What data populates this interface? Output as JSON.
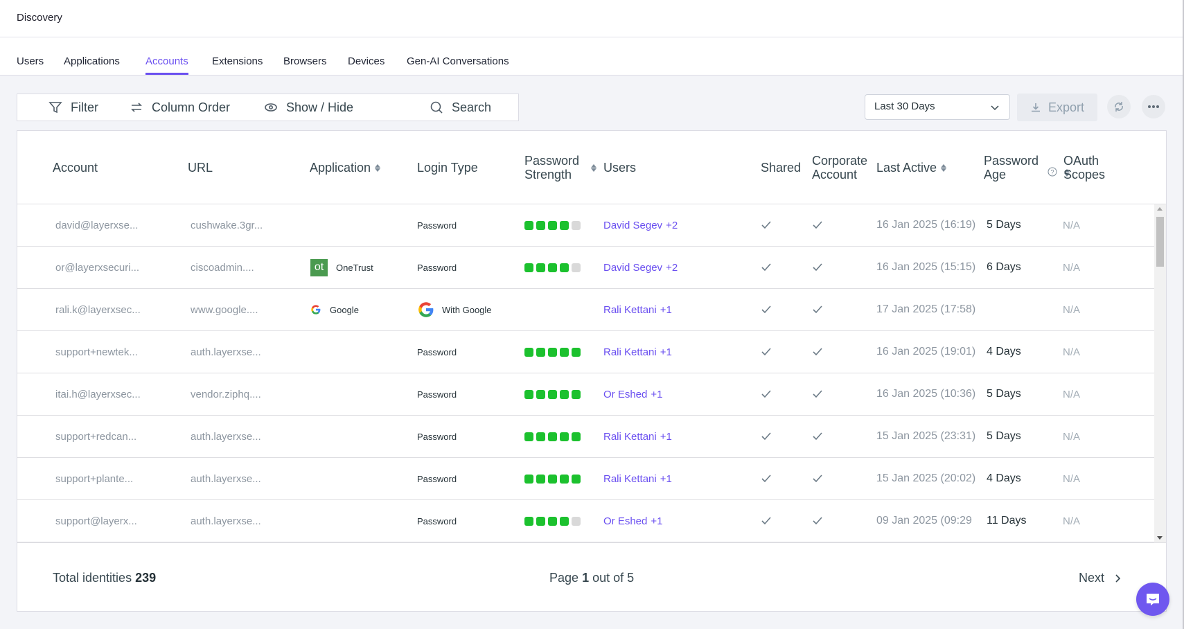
{
  "header": {
    "title": "Discovery"
  },
  "tabs": [
    {
      "label": "Users",
      "active": false
    },
    {
      "label": "Applications",
      "active": false
    },
    {
      "label": "Accounts",
      "active": true
    },
    {
      "label": "Extensions",
      "active": false
    },
    {
      "label": "Browsers",
      "active": false
    },
    {
      "label": "Devices",
      "active": false
    },
    {
      "label": "Gen-AI Conversations",
      "active": false
    }
  ],
  "toolbar": {
    "filter_label": "Filter",
    "column_order_label": "Column Order",
    "show_hide_label": "Show / Hide",
    "search_label": "Search",
    "date_range": "Last 30 Days",
    "export_label": "Export"
  },
  "colors": {
    "accent": "#6a4ff0",
    "strength_on": "#1cc12e",
    "strength_off": "#d9d9d9",
    "onetrust": "#4a9a4f"
  },
  "table": {
    "columns": [
      {
        "label": "Account",
        "sortable": false
      },
      {
        "label": "URL",
        "sortable": false
      },
      {
        "label": "Application",
        "sortable": true
      },
      {
        "label": "Login Type",
        "sortable": false
      },
      {
        "label": "Password Strength",
        "sortable": true
      },
      {
        "label": "Users",
        "sortable": false
      },
      {
        "label": "Shared",
        "sortable": false
      },
      {
        "label": "Corporate Account",
        "sortable": false
      },
      {
        "label": "Last Active",
        "sortable": true
      },
      {
        "label": "Password Age",
        "sortable": true,
        "help": true
      },
      {
        "label": "OAuth Scopes",
        "sortable": false
      }
    ],
    "rows": [
      {
        "account": "david@layerxse...",
        "url": "cushwake.3gr...",
        "app": "",
        "app_icon": "",
        "login": "Password",
        "login_icon": "",
        "strength": 4,
        "user": "David Segev",
        "extra": "+2",
        "shared": true,
        "corporate": true,
        "last_active": "16 Jan 2025 (16:19)",
        "age": "5 Days",
        "oauth": "N/A"
      },
      {
        "account": "or@layerxsecuri...",
        "url": "ciscoadmin....",
        "app": "OneTrust",
        "app_icon": "onetrust",
        "app_icon_text": "ot",
        "login": "Password",
        "login_icon": "",
        "strength": 4,
        "user": "David Segev",
        "extra": "+2",
        "shared": true,
        "corporate": true,
        "last_active": "16 Jan 2025 (15:15)",
        "age": "6 Days",
        "oauth": "N/A"
      },
      {
        "account": "rali.k@layerxsec...",
        "url": "www.google....",
        "app": "Google",
        "app_icon": "google",
        "login": "With Google",
        "login_icon": "google",
        "strength": 0,
        "user": "Rali Kettani",
        "extra": "+1",
        "shared": true,
        "corporate": true,
        "last_active": "17 Jan 2025 (17:58)",
        "age": "",
        "oauth": "N/A"
      },
      {
        "account": "support+newtek...",
        "url": "auth.layerxse...",
        "app": "",
        "app_icon": "",
        "login": "Password",
        "login_icon": "",
        "strength": 5,
        "user": "Rali Kettani",
        "extra": "+1",
        "shared": true,
        "corporate": true,
        "last_active": "16 Jan 2025 (19:01)",
        "age": "4 Days",
        "oauth": "N/A"
      },
      {
        "account": "itai.h@layerxsec...",
        "url": "vendor.ziphq....",
        "app": "",
        "app_icon": "",
        "login": "Password",
        "login_icon": "",
        "strength": 5,
        "user": "Or Eshed",
        "extra": "+1",
        "shared": true,
        "corporate": true,
        "last_active": "16 Jan 2025 (10:36)",
        "age": "5 Days",
        "oauth": "N/A"
      },
      {
        "account": "support+redcan...",
        "url": "auth.layerxse...",
        "app": "",
        "app_icon": "",
        "login": "Password",
        "login_icon": "",
        "strength": 5,
        "user": "Rali Kettani",
        "extra": "+1",
        "shared": true,
        "corporate": true,
        "last_active": "15 Jan 2025 (23:31)",
        "age": "5 Days",
        "oauth": "N/A"
      },
      {
        "account": "support+plante...",
        "url": "auth.layerxse...",
        "app": "",
        "app_icon": "",
        "login": "Password",
        "login_icon": "",
        "strength": 5,
        "user": "Rali Kettani",
        "extra": "+1",
        "shared": true,
        "corporate": true,
        "last_active": "15 Jan 2025 (20:02)",
        "age": "4 Days",
        "oauth": "N/A"
      },
      {
        "account": "support@layerx...",
        "url": "auth.layerxse...",
        "app": "",
        "app_icon": "",
        "login": "Password",
        "login_icon": "",
        "strength": 4,
        "user": "Or Eshed",
        "extra": "+1",
        "shared": true,
        "corporate": true,
        "last_active": "09 Jan 2025 (09:29",
        "age": "11 Days",
        "oauth": "N/A"
      }
    ]
  },
  "footer": {
    "total_label": "Total identities",
    "total_value": "239",
    "page_prefix": "Page",
    "page_current": "1",
    "page_suffix": "out of 5",
    "next_label": "Next"
  }
}
